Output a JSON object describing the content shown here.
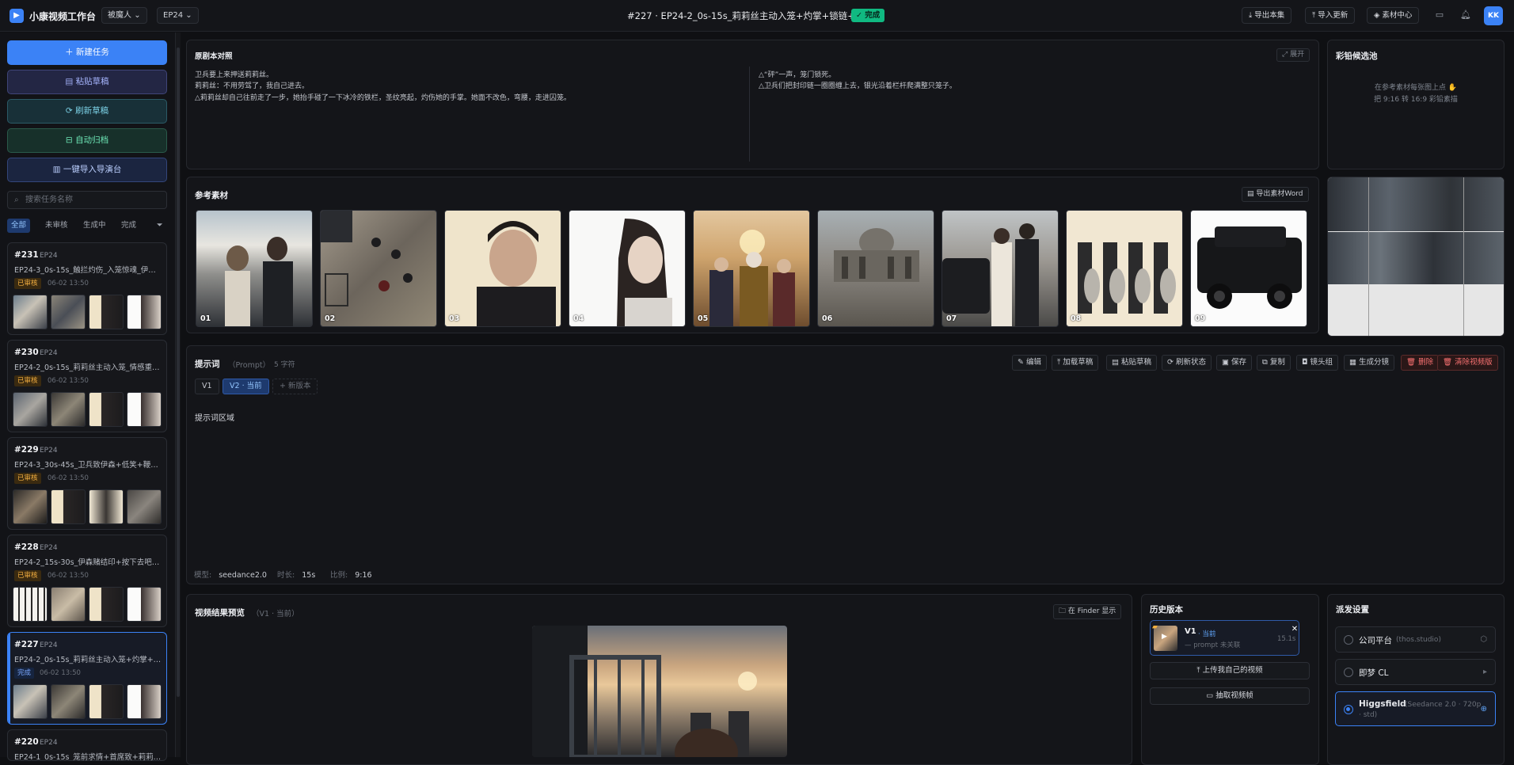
{
  "header": {
    "app_title": "小康视频工作台",
    "workspace": "被魔人",
    "episode": "EP24",
    "task_title": "#227 · EP24-2_0s-15s_莉莉丝主动入笼+灼掌+锁链+缠链",
    "status_badge": "完成",
    "export_label": "导出本集",
    "import_label": "导入更新",
    "assets_label": "素材中心",
    "avatar_text": "KK"
  },
  "sidebar": {
    "buttons": {
      "new_task": "新建任务",
      "paste_draft": "粘贴草稿",
      "refresh_draft": "刷新草稿",
      "auto_archive": "自动归档",
      "one_click_import": "一键导入导演台"
    },
    "search_placeholder": "搜索任务名称",
    "filters": [
      "全部",
      "未审核",
      "生成中",
      "完成"
    ],
    "tasks": [
      {
        "id": "#231",
        "ep": "EP24",
        "name": "EP24-3_0s-15s_触拦灼伤_入笼惊魂_伊森...",
        "status": "已审核",
        "time": "06-02 13:50"
      },
      {
        "id": "#230",
        "ep": "EP24",
        "name": "EP24-2_0s-15s_莉莉丝主动入笼_情感重排...",
        "status": "已审核",
        "time": "06-02 13:50"
      },
      {
        "id": "#229",
        "ep": "EP24",
        "name": "EP24-3_30s-45s_卫兵致伊森+低笑+鞭解...",
        "status": "已审核",
        "time": "06-02 13:50"
      },
      {
        "id": "#228",
        "ep": "EP24",
        "name": "EP24-2_15s-30s_伊森赌结印+按下去吧+...",
        "status": "已审核",
        "time": "06-02 13:50"
      },
      {
        "id": "#227",
        "ep": "EP24",
        "name": "EP24-2_0s-15s_莉莉丝主动入笼+灼掌+锁...",
        "status": "完成",
        "time": "06-02 13:50"
      },
      {
        "id": "#220",
        "ep": "EP24",
        "name": "EP24-1_0s-15s_笼前求情+首席致+莉莉丝...",
        "status": "",
        "time": ""
      }
    ]
  },
  "script_panel": {
    "title": "原剧本对照",
    "expand_label": "展开",
    "left_lines": [
      "卫兵要上来押送莉莉丝。",
      "莉莉丝：不用劳驾了，我自己进去。",
      "△莉莉丝却自己往前走了一步，她抬手碰了一下冰冷的铁栏，圣纹亮起，灼伤她的手掌。她面不改色，弯腰，走进囚笼。"
    ],
    "right_lines": [
      "△“砰”一声，笼门锁死。",
      "△卫兵们把封印链一圈圈缠上去，银光沿着栏杆爬满整只笼子。"
    ]
  },
  "storyboard_panel": {
    "title": "彩铅候选池",
    "hint_line1": "在参考素材每张图上点 ✋",
    "hint_line2": "把 9:16 转 16:9 彩铅素描"
  },
  "reference_panel": {
    "title": "参考素材",
    "export_word_label": "导出素材Word",
    "items": [
      "01",
      "02",
      "03",
      "04",
      "05",
      "06",
      "07",
      "08",
      "09"
    ]
  },
  "prompt_panel": {
    "title": "提示词",
    "subtitle": "（Prompt）",
    "char_count": "5 字符",
    "buttons": [
      "编辑",
      "加载草稿",
      "粘贴草稿",
      "刷新状态",
      "保存",
      "复制",
      "镜头组",
      "生成分镜",
      "删除",
      "清除视频版"
    ],
    "versions": [
      "V1",
      "V2 · 当前",
      "+ 新版本"
    ],
    "body": "提示词区域",
    "meta": {
      "model_key": "模型:",
      "model_val": "seedance2.0",
      "duration_key": "时长:",
      "duration_val": "15s",
      "ratio_key": "比例:",
      "ratio_val": "9:16"
    }
  },
  "preview_panel": {
    "title": "视频结果预览",
    "subtitle": "（V1 · 当前）",
    "finder_label": "在 Finder 显示"
  },
  "history_panel": {
    "title": "历史版本",
    "card_version": "V1",
    "card_current": "· 当前",
    "card_sub": "— prompt 未关联",
    "card_duration": "15.1s",
    "upload_label": "上传我自己的视频",
    "extract_label": "抽取视频帧"
  },
  "dist_panel": {
    "title": "派发设置",
    "options": [
      {
        "name": "公司平台",
        "sub": "(thos.studio)"
      },
      {
        "name": "即梦 CL",
        "sub": ""
      },
      {
        "name": "Higgsfield",
        "sub": "(Seedance 2.0 · 720p",
        "sub2": "· std)"
      }
    ]
  },
  "colors": {
    "accent": "#3b82f6",
    "done": "#10b981",
    "review": "#f5b041",
    "danger": "#f87171"
  }
}
